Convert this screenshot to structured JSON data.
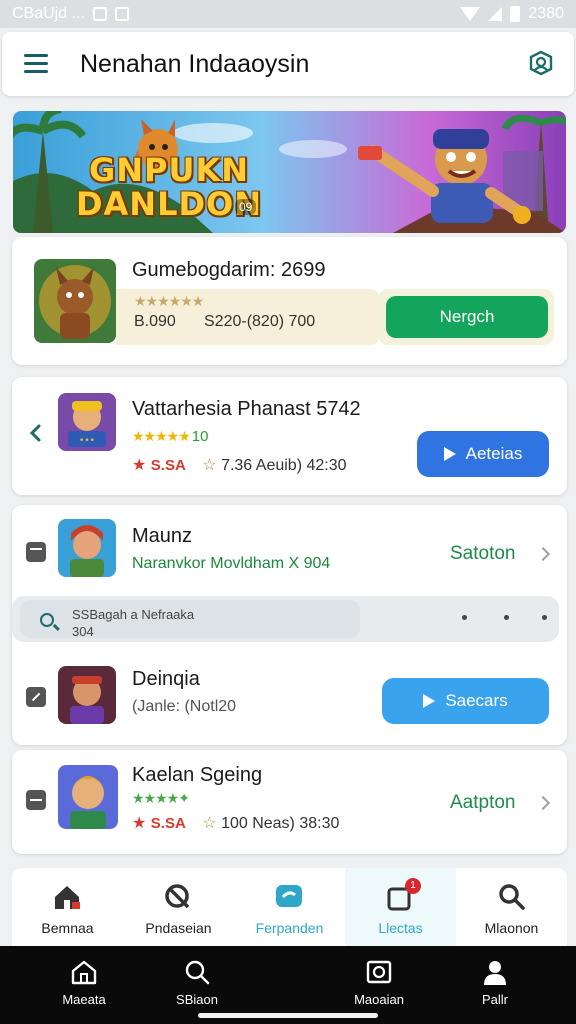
{
  "status_bar": {
    "left_text": "CBaUjd ...",
    "time": "2380"
  },
  "app_bar": {
    "title": "Nenahan Indaaoysin"
  },
  "banner": {
    "title": "GNPUKN DANLDON",
    "badge": "09"
  },
  "featured": {
    "title": "Gumebogdarim: 2699",
    "meta_left": "B.090",
    "meta_mid": "S220-(820) 700",
    "button_label": "Nergch",
    "button_color": "#12a55b"
  },
  "items": [
    {
      "title": "Vattarhesia Phanast 5742",
      "rating_count": "10",
      "price": "S.SA",
      "meta": "7.36 Aeuib) 42:30",
      "button_label": "Aeteias",
      "button_color": "#2f74e0"
    },
    {
      "title": "Maunz",
      "subtitle": "Naranvkor Movldham X 904",
      "action_label": "Satoton"
    },
    {
      "title": "Deinqia",
      "subtitle": "(Janle: (Notl20",
      "button_label": "Saecars",
      "button_color": "#3aa3ee"
    },
    {
      "title": "Kaelan Sgeing",
      "price": "S.SA",
      "meta": "100 Neas) 38:30",
      "action_label": "Aatpton"
    }
  ],
  "search": {
    "line1": "SSBagah a Nefraaka",
    "line2": "304"
  },
  "tabs": [
    {
      "label": "Bemnaa",
      "icon": "home-icon"
    },
    {
      "label": "Pndaseian",
      "icon": "no-entry-icon"
    },
    {
      "label": "Ferpanden",
      "icon": "chat-icon"
    },
    {
      "label": "Llectas",
      "icon": "bell-icon",
      "badge": "1"
    },
    {
      "label": "Mlaonon",
      "icon": "search-icon"
    }
  ],
  "system_nav": [
    {
      "label": "Maeata",
      "icon": "home-icon"
    },
    {
      "label": "SBiaon",
      "icon": "search-icon"
    },
    {
      "label": "Maoaian",
      "icon": "camera-icon"
    },
    {
      "label": "Pallr",
      "icon": "person-icon"
    }
  ],
  "colors": {
    "accent_teal": "#1a6d6b",
    "green": "#12a55b",
    "blue": "#2f74e0",
    "light_blue": "#3aa3ee"
  }
}
